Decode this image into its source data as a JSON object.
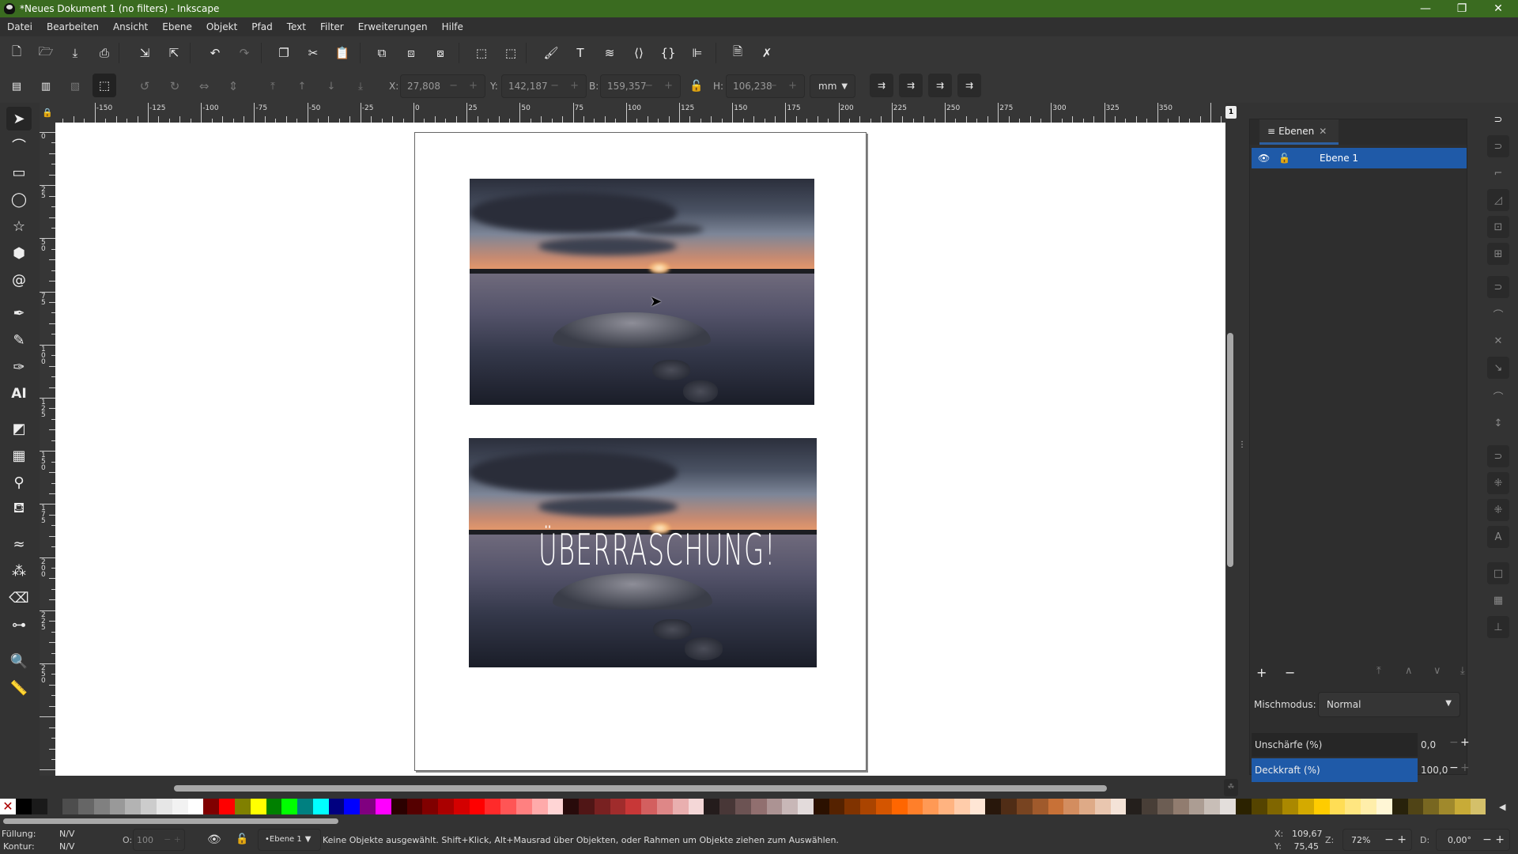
{
  "window": {
    "title": "*Neues Dokument 1 (no filters) - Inkscape",
    "controls": {
      "minimize": "—",
      "restore": "❐",
      "close": "✕"
    }
  },
  "menu": [
    "Datei",
    "Bearbeiten",
    "Ansicht",
    "Ebene",
    "Objekt",
    "Pfad",
    "Text",
    "Filter",
    "Erweiterungen",
    "Hilfe"
  ],
  "commands_bar": [
    {
      "name": "new-document-icon",
      "glyph": "🗋"
    },
    {
      "name": "open-document-icon",
      "glyph": "🗁"
    },
    {
      "name": "save-icon",
      "glyph": "⤓"
    },
    {
      "name": "print-icon",
      "glyph": "⎙"
    },
    {
      "name": "import-icon",
      "glyph": "⇲"
    },
    {
      "name": "export-icon",
      "glyph": "⇱"
    },
    {
      "name": "undo-icon",
      "glyph": "↶"
    },
    {
      "name": "redo-icon",
      "glyph": "↷"
    },
    {
      "name": "copy-icon",
      "glyph": "❐"
    },
    {
      "name": "cut-icon",
      "glyph": "✂"
    },
    {
      "name": "paste-icon",
      "glyph": "📋"
    },
    {
      "name": "duplicate-icon",
      "glyph": "⧉"
    },
    {
      "name": "clone-icon",
      "glyph": "⧈"
    },
    {
      "name": "unlink-clone-icon",
      "glyph": "⧇"
    },
    {
      "name": "group-icon",
      "glyph": "⬚"
    },
    {
      "name": "ungroup-icon",
      "glyph": "⬚"
    },
    {
      "name": "fill-stroke-icon",
      "glyph": "🖌"
    },
    {
      "name": "text-font-icon",
      "glyph": "T"
    },
    {
      "name": "layers-objects-icon",
      "glyph": "≋"
    },
    {
      "name": "xml-editor-icon",
      "glyph": "⟨⟩"
    },
    {
      "name": "selectors-css-icon",
      "glyph": "{}"
    },
    {
      "name": "align-distribute-icon",
      "glyph": "⊫"
    },
    {
      "name": "document-properties-icon",
      "glyph": "🗎"
    },
    {
      "name": "preferences-icon",
      "glyph": "✗"
    }
  ],
  "tool_controls": {
    "x_label": "X:",
    "x_value": "27,808",
    "y_label": "Y:",
    "y_value": "142,187",
    "w_label": "B:",
    "w_value": "159,357",
    "h_label": "H:",
    "h_value": "106,238",
    "unit": "mm",
    "pm": "− +"
  },
  "tools": [
    {
      "name": "selector-tool-icon",
      "glyph": "➤",
      "active": true
    },
    {
      "name": "node-tool-icon",
      "glyph": "⌒"
    },
    {
      "name": "rectangle-tool-icon",
      "glyph": "▭"
    },
    {
      "name": "ellipse-tool-icon",
      "glyph": "◯"
    },
    {
      "name": "star-tool-icon",
      "glyph": "☆"
    },
    {
      "name": "3d-box-tool-icon",
      "glyph": "⬢"
    },
    {
      "name": "spiral-tool-icon",
      "glyph": "@"
    },
    {
      "name": "bezier-pen-tool-icon",
      "glyph": "✒"
    },
    {
      "name": "pencil-tool-icon",
      "glyph": "✎"
    },
    {
      "name": "calligraphy-tool-icon",
      "glyph": "✑"
    },
    {
      "name": "text-tool-icon",
      "glyph": "AI"
    },
    {
      "name": "gradient-tool-icon",
      "glyph": "◩"
    },
    {
      "name": "mesh-tool-icon",
      "glyph": "▦"
    },
    {
      "name": "dropper-tool-icon",
      "glyph": "⚲"
    },
    {
      "name": "paint-bucket-tool-icon",
      "glyph": "⛾"
    },
    {
      "name": "tweak-tool-icon",
      "glyph": "≈"
    },
    {
      "name": "spray-tool-icon",
      "glyph": "⁂"
    },
    {
      "name": "eraser-tool-icon",
      "glyph": "⌫"
    },
    {
      "name": "connector-tool-icon",
      "glyph": "⊶"
    },
    {
      "name": "zoom-tool-icon",
      "glyph": "🔍"
    },
    {
      "name": "measure-tool-icon",
      "glyph": "📏"
    }
  ],
  "ruler": {
    "h_labels": [
      "-150",
      "-125",
      "-100",
      "-75",
      "-50",
      "-25",
      "0",
      "25",
      "50",
      "75",
      "100",
      "125",
      "150",
      "175",
      "200",
      "225",
      "250",
      "275",
      "300",
      "325",
      "350"
    ],
    "v_labels": [
      "0",
      "25",
      "50",
      "75",
      "100",
      "125",
      "150",
      "175",
      "200",
      "225",
      "250"
    ],
    "page_badge": "1"
  },
  "canvas": {
    "overlay_text": "ÜBERRASCHUNG!"
  },
  "layers_panel": {
    "tab_label": "Ebenen",
    "layers": [
      {
        "name": "Ebene 1",
        "visible": true,
        "locked": false,
        "selected": true
      }
    ],
    "blend_label": "Mischmodus:",
    "blend_value": "Normal",
    "blur_label": "Unschärfe (%)",
    "blur_value": "0,0",
    "opacity_label": "Deckkraft (%)",
    "opacity_value": "100,0"
  },
  "palette": [
    "#000000",
    "#1a1a1a",
    "#333333",
    "#4d4d4d",
    "#666666",
    "#808080",
    "#999999",
    "#b3b3b3",
    "#cccccc",
    "#e6e6e6",
    "#f2f2f2",
    "#ffffff",
    "#800000",
    "#ff0000",
    "#808000",
    "#ffff00",
    "#008000",
    "#00ff00",
    "#008080",
    "#00ffff",
    "#000080",
    "#0000ff",
    "#800080",
    "#ff00ff",
    "#2b0000",
    "#550000",
    "#800000",
    "#aa0000",
    "#d40000",
    "#ff0000",
    "#ff2a2a",
    "#ff5555",
    "#ff8080",
    "#ffaaaa",
    "#ffd5d5",
    "#280b0b",
    "#501616",
    "#782121",
    "#a02c2c",
    "#c83737",
    "#d35f5f",
    "#de8787",
    "#e9afaf",
    "#f4d7d7",
    "#241c1c",
    "#483737",
    "#6c5353",
    "#916f6f",
    "#ac9393",
    "#c8b7b7",
    "#e3dbdb",
    "#2b1100",
    "#552200",
    "#803300",
    "#aa4400",
    "#d45500",
    "#ff6600",
    "#ff7f2a",
    "#ff9955",
    "#ffb380",
    "#ffccaa",
    "#ffe6d5",
    "#28170b",
    "#502d16",
    "#784421",
    "#a05a2c",
    "#c87137",
    "#d38d5f",
    "#deaa87",
    "#e9c6af",
    "#f4e3d7",
    "#241f1c",
    "#483e37",
    "#6c5d53",
    "#917c6f",
    "#ac9d93",
    "#c8beb7",
    "#e3dedb",
    "#2b2200",
    "#554400",
    "#806600",
    "#aa8800",
    "#d4aa00",
    "#ffcc00",
    "#ffdd55",
    "#ffe680",
    "#ffeeaa",
    "#fff6d5",
    "#28220b",
    "#504416",
    "#786721",
    "#a0892c",
    "#c8ab37",
    "#d4c06a"
  ],
  "statusbar": {
    "fill_label": "Füllung:",
    "fill_value": "N/V",
    "stroke_label": "Kontur:",
    "stroke_value": "N/V",
    "opacity_label": "O:",
    "opacity_value": "100",
    "layer_value": "•Ebene 1",
    "message": "Keine Objekte ausgewählt. Shift+Klick, Alt+Mausrad über Objekten, oder Rahmen um Objekte ziehen zum Auswählen.",
    "cursor_x_label": "X:",
    "cursor_x": "109,67",
    "cursor_y_label": "Y:",
    "cursor_y": "75,45",
    "zoom_label": "Z:",
    "zoom_value": "72%",
    "rotation_label": "D:",
    "rotation_value": "0,00°"
  }
}
